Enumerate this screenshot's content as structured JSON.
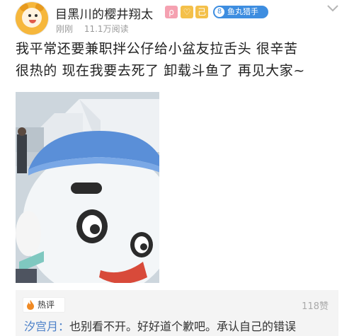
{
  "user": {
    "name": "目黑川的樱井翔太",
    "badges": [
      "search-badge",
      "heart-badge",
      "checkin-badge"
    ],
    "badge_glyphs": [
      "ρ",
      "♡",
      "己"
    ],
    "level_number": "8",
    "level_text": "鱼丸猎手",
    "time": "刚刚",
    "reads": "11.1万阅读"
  },
  "post": {
    "line1": "我平常还要兼职拌公仔给小盆友拉舌头 很辛苦",
    "line2": "很热的 现在我要去死了 卸载斗鱼了 再见大家~"
  },
  "comments": {
    "section_label": "热评",
    "likes": "118赞",
    "author": "汐宫月：",
    "text": "也别看不开。好好道个歉吧。承认自己的错误"
  },
  "colors": {
    "accent_blue": "#3d8de0",
    "link_blue": "#4a7fc8",
    "hot_orange": "#f08a24"
  }
}
